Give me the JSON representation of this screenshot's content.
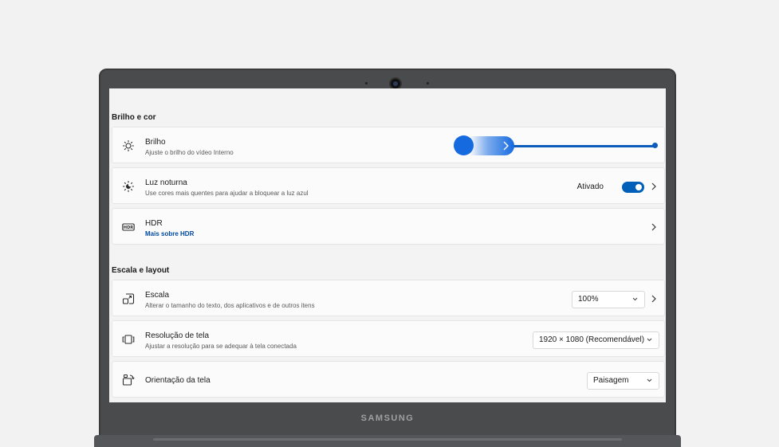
{
  "device": {
    "brand": "SAMSUNG"
  },
  "sections": {
    "brightness_color": {
      "title": "Brilho e cor"
    },
    "scale_layout": {
      "title": "Escala e layout"
    }
  },
  "settings": {
    "brightness": {
      "label": "Brilho",
      "description": "Ajuste o brilho do vídeo Interno",
      "icon": "sun-icon",
      "level_percent": 100
    },
    "night_light": {
      "label": "Luz noturna",
      "description": "Use cores mais quentes para ajudar a bloquear a luz azul",
      "status": "Ativado",
      "enabled": true,
      "icon": "night-light-icon"
    },
    "hdr": {
      "label": "HDR",
      "link": "Mais sobre HDR",
      "icon": "hdr-icon"
    },
    "scale": {
      "label": "Escala",
      "description": "Alterar o tamanho do texto, dos aplicativos e de outros itens",
      "value": "100%",
      "icon": "scale-icon"
    },
    "resolution": {
      "label": "Resolução de tela",
      "description": "Ajustar a resolução para se adequar à tela conectada",
      "value": "1920 × 1080 (Recomendável)",
      "icon": "resolution-icon"
    },
    "orientation": {
      "label": "Orientação da tela",
      "value": "Paisagem",
      "icon": "orientation-icon"
    }
  },
  "colors": {
    "accent": "#005fb8",
    "slider": "#156ae0",
    "link": "#00489e"
  }
}
